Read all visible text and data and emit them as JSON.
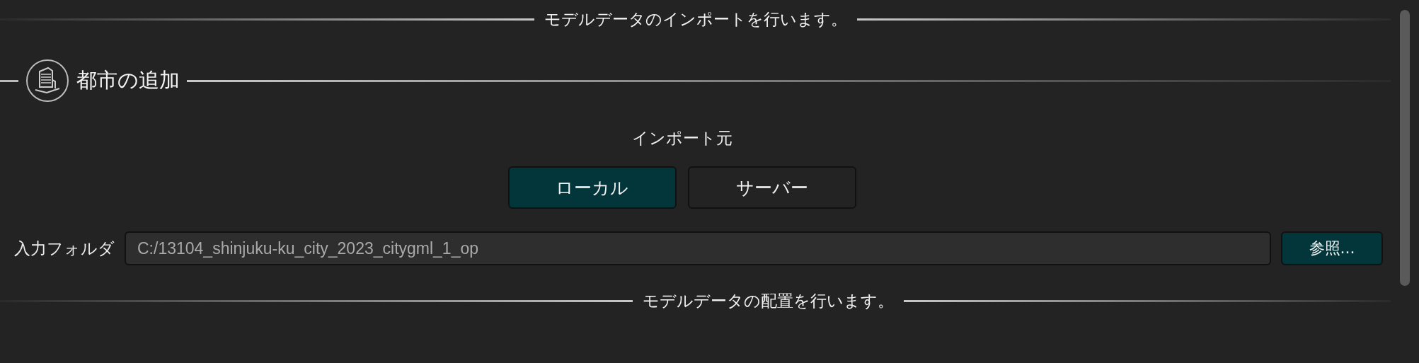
{
  "top_divider": {
    "label": "モデルデータのインポートを行います。"
  },
  "section": {
    "title": "都市の追加"
  },
  "import_source": {
    "label": "インポート元",
    "options": [
      {
        "label": "ローカル",
        "selected": true
      },
      {
        "label": "サーバー",
        "selected": false
      }
    ]
  },
  "input_folder": {
    "label": "入力フォルダ",
    "value": "C:/13104_shinjuku-ku_city_2023_citygml_1_op",
    "button": "参照..."
  },
  "bottom_divider": {
    "label": "モデルデータの配置を行います。"
  }
}
